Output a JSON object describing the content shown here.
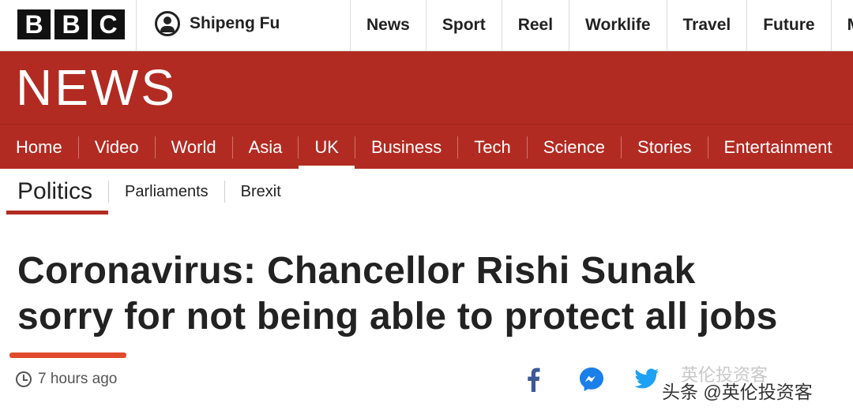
{
  "header": {
    "logo_letters": [
      "B",
      "B",
      "C"
    ],
    "account_name": "Shipeng Fu",
    "nav": [
      "News",
      "Sport",
      "Reel",
      "Worklife",
      "Travel",
      "Future",
      "M"
    ]
  },
  "banner": {
    "title": "NEWS",
    "color": "#b22b22"
  },
  "section_nav": {
    "items": [
      "Home",
      "Video",
      "World",
      "Asia",
      "UK",
      "Business",
      "Tech",
      "Science",
      "Stories",
      "Entertainment"
    ],
    "active": "UK"
  },
  "sub_nav": {
    "current": "Politics",
    "items": [
      "Parliaments",
      "Brexit"
    ]
  },
  "article": {
    "headline_line1": "Coronavirus: Chancellor Rishi Sunak",
    "headline_line2": "sorry for not being able to protect all jobs",
    "timestamp": "7 hours ago"
  },
  "share": [
    "facebook-icon",
    "messenger-icon",
    "twitter-icon"
  ],
  "watermark": "头条 @英伦投资客",
  "watermark_faint": "英伦投资客"
}
